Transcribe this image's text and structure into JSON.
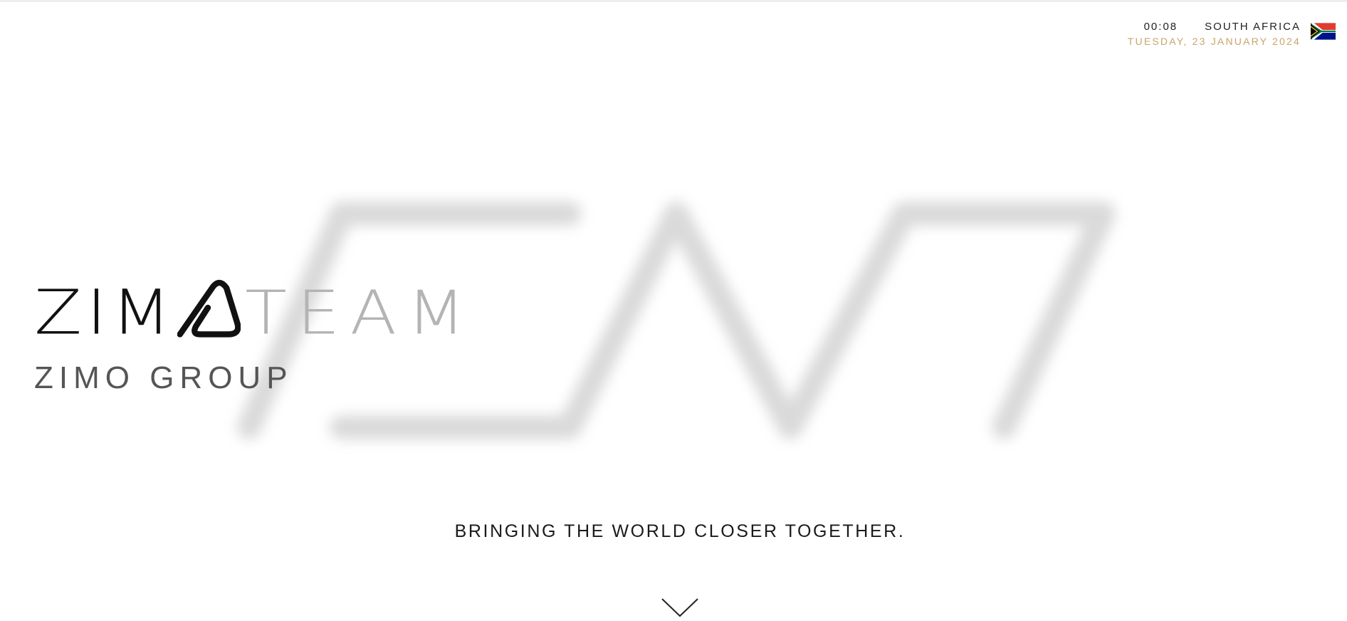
{
  "header": {
    "time": "00:08",
    "country": "SOUTH AFRICA",
    "date": "TUESDAY, 23 JANUARY 2024",
    "flag_icon": "south-africa-flag-icon"
  },
  "logo": {
    "word_dark": "ZIM",
    "word_light": "TEAM",
    "subtitle": "ZIMO GROUP"
  },
  "hero": {
    "tagline": "BRINGING THE WORLD CLOSER TOGETHER.",
    "scroll_icon": "chevron-down-icon"
  },
  "colors": {
    "accent_gold": "#c9a46b",
    "text_dark": "#111111",
    "text_grey": "#b4b4b4",
    "watermark": "#d8d8d8"
  }
}
